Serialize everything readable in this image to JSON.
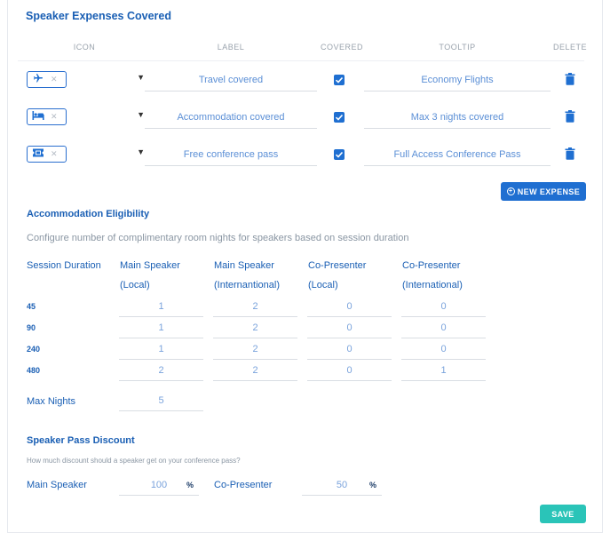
{
  "expenses": {
    "title": "Speaker Expenses Covered",
    "headers": {
      "icon": "ICON",
      "label": "LABEL",
      "covered": "COVERED",
      "tooltip": "TOOLTIP",
      "delete": "DELETE"
    },
    "rows": [
      {
        "icon": "airplane-icon",
        "label": "Travel covered",
        "covered": true,
        "tooltip": "Economy Flights"
      },
      {
        "icon": "bed-icon",
        "label": "Accommodation covered",
        "covered": true,
        "tooltip": "Max 3 nights covered"
      },
      {
        "icon": "ticket-icon",
        "label": "Free conference pass",
        "covered": true,
        "tooltip": "Full Access Conference Pass"
      }
    ],
    "new_button": "NEW EXPENSE"
  },
  "accommodation": {
    "title": "Accommodation Eligibility",
    "description": "Configure number of complimentary room nights for speakers based on session duration",
    "columns": [
      {
        "line1": "Session Duration",
        "line2": ""
      },
      {
        "line1": "Main Speaker",
        "line2": "(Local)"
      },
      {
        "line1": "Main Speaker",
        "line2": "(Internantional)"
      },
      {
        "line1": "Co-Presenter",
        "line2": "(Local)"
      },
      {
        "line1": "Co-Presenter",
        "line2": "(International)"
      }
    ],
    "rows": [
      {
        "duration": "45",
        "values": [
          "1",
          "2",
          "0",
          "0"
        ]
      },
      {
        "duration": "90",
        "values": [
          "1",
          "2",
          "0",
          "0"
        ]
      },
      {
        "duration": "240",
        "values": [
          "1",
          "2",
          "0",
          "0"
        ]
      },
      {
        "duration": "480",
        "values": [
          "2",
          "2",
          "0",
          "1"
        ]
      }
    ],
    "max_nights_label": "Max Nights",
    "max_nights_value": "5"
  },
  "discount": {
    "title": "Speaker Pass Discount",
    "description": "How much discount should a speaker get on your conference pass?",
    "main_label": "Main Speaker",
    "main_value": "100",
    "co_label": "Co-Presenter",
    "co_value": "50",
    "unit": "%"
  },
  "save_button": "SAVE",
  "colors": {
    "primary": "#1f6fd1",
    "title": "#1a5fb4",
    "save": "#2ac4b8"
  }
}
